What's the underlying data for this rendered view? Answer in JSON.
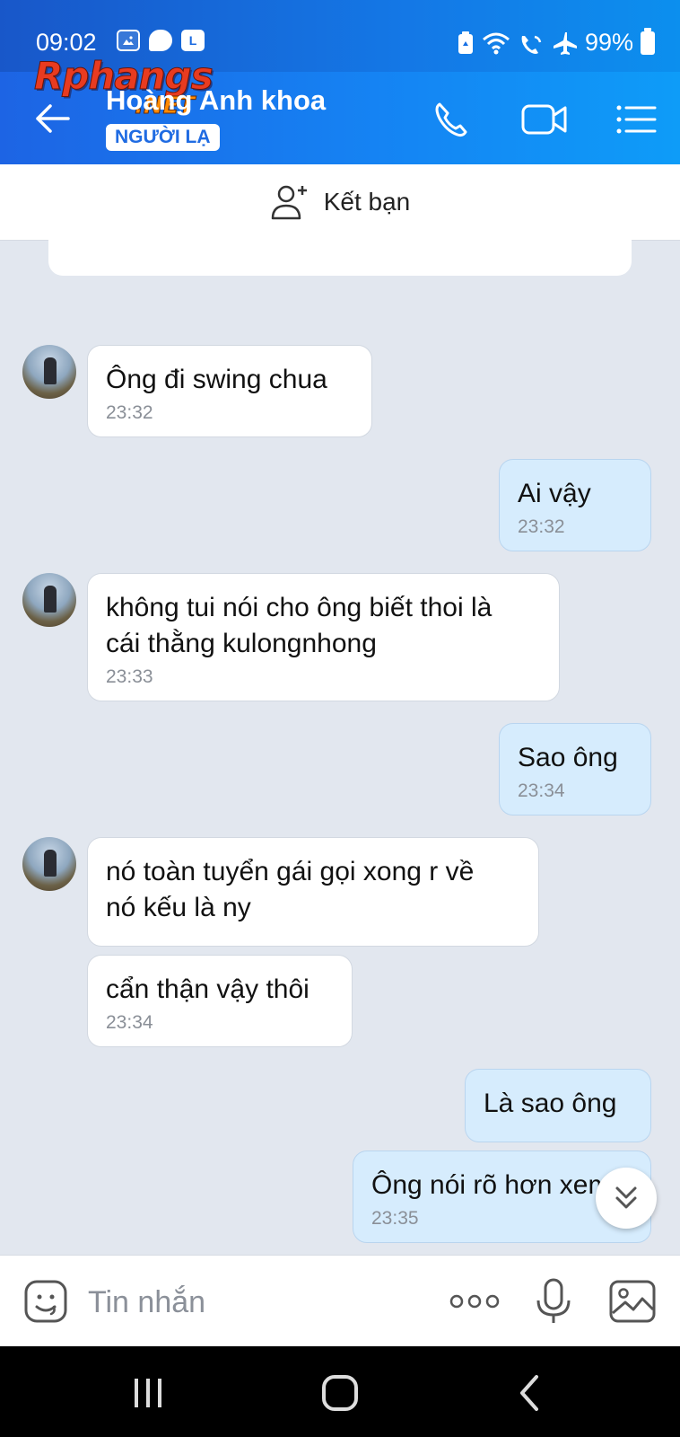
{
  "status_bar": {
    "time": "09:02",
    "battery": "99%",
    "notif_letter": "L"
  },
  "watermark": {
    "brand": "Rphangs",
    "suffix": ".NET"
  },
  "header": {
    "name": "Hoàng Anh khoa",
    "badge": "NGƯỜI LẠ"
  },
  "friend_bar": {
    "label": "Kết bạn"
  },
  "messages": [
    {
      "dir": "in",
      "text": "Ông đi swing chua",
      "time": "23:32"
    },
    {
      "dir": "out",
      "text": "Ai vậy",
      "time": "23:32"
    },
    {
      "dir": "in",
      "text": "không tui nói cho ông biết thoi là\ncái thằng kulongnhong",
      "time": "23:33"
    },
    {
      "dir": "out",
      "text": "Sao ông",
      "time": "23:34"
    },
    {
      "dir": "in",
      "text": "nó toàn tuyển gái gọi xong r về\nnó kếu là ny",
      "time": ""
    },
    {
      "dir": "in",
      "text": "cẩn thận vậy thôi",
      "time": "23:34"
    },
    {
      "dir": "out",
      "text": "Là sao ông",
      "time": ""
    },
    {
      "dir": "out",
      "text": "Ông nói rõ hơn xem",
      "time": "23:35"
    }
  ],
  "input": {
    "placeholder": "Tin nhắn"
  },
  "colors": {
    "header_start": "#1d64e4",
    "header_end": "#0e9cf8",
    "bubble_out": "#d6ecfd",
    "bubble_in": "#ffffff",
    "chat_bg": "#e2e7ef"
  }
}
